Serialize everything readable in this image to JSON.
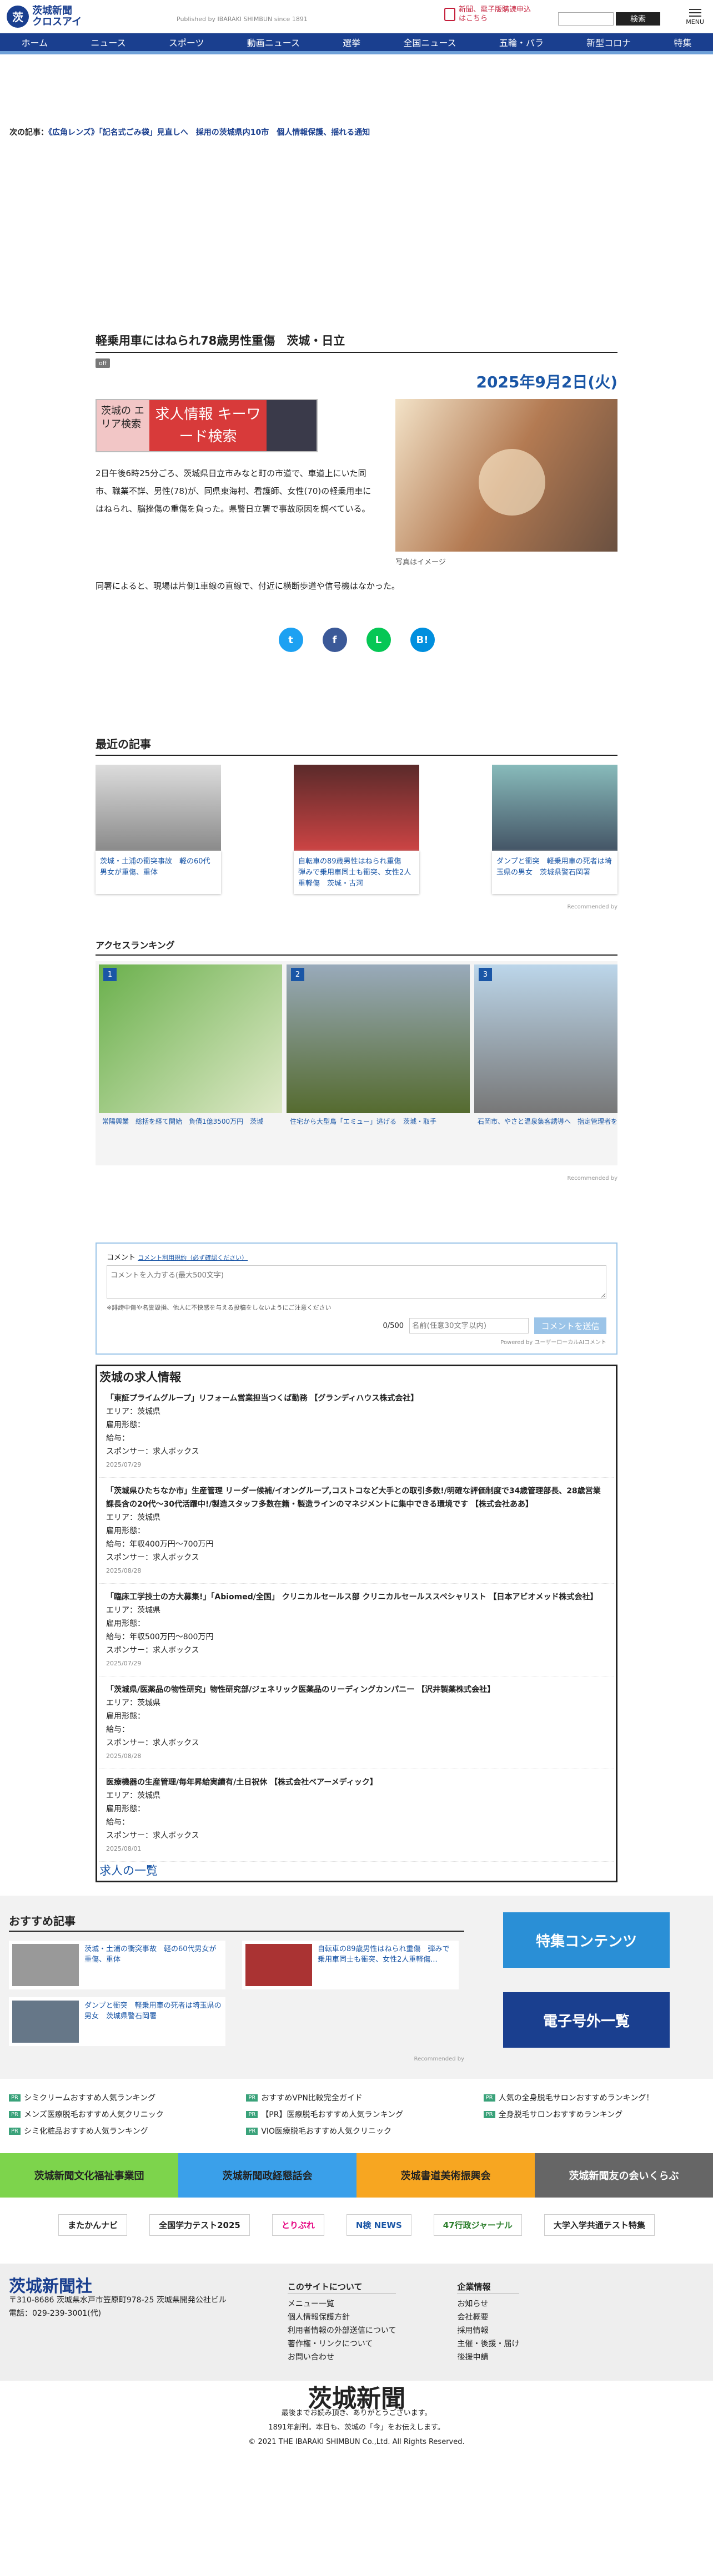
{
  "header": {
    "logo_mark": "茨",
    "logo_text_1": "茨城新聞",
    "logo_text_2": "クロスアイ",
    "published": "Published by IBARAKI SHIMBUN since 1891",
    "subscribe": "新聞、電子版購読申込はこちら",
    "search_button": "検索",
    "menu": "MENU"
  },
  "nav": [
    "ホーム",
    "ニュース",
    "スポーツ",
    "動画ニュース",
    "選挙",
    "全国ニュース",
    "五輪・パラ",
    "新型コロナ",
    "特集"
  ],
  "next": {
    "label": "次の記事：",
    "text": "《広角レンズ》「記名式ごみ袋」見直しへ　採用の茨城県内10市　個人情報保護、揺れる通知"
  },
  "article": {
    "title": "軽乗用車にはねられ78歳男性重傷　茨城・日立",
    "off": "off",
    "date": "2025年9月2日(火)",
    "banner": {
      "left": "茨城の エリア検索",
      "mid": "求人情報 キーワード検索"
    },
    "para1": "2日午後6時25分ごろ、茨城県日立市みなと町の市道で、車道上にいた同市、職業不詳、男性(78)が、同県東海村、看護師、女性(70)の軽乗用車にはねられ、脳挫傷の重傷を負った。県警日立署で事故原因を調べている。",
    "caption": "写真はイメージ",
    "para2": "同署によると、現場は片側1車線の直線で、付近に横断歩道や信号機はなかった。"
  },
  "share": [
    "t",
    "f",
    "L",
    "B!"
  ],
  "recent": {
    "title": "最近の記事",
    "items": [
      "茨城・土浦の衝突事故　軽の60代男女が重傷、重体",
      "自転車の89歳男性はねられ重傷　弾みで乗用車同士も衝突、女性2人重軽傷　茨城・古河",
      "ダンプと衝突　軽乗用車の死者は埼玉県の男女　茨城県警石岡署"
    ],
    "recommended": "Recommended by"
  },
  "ranking": {
    "title": "アクセスランキング",
    "items": [
      {
        "num": "1",
        "text": "常陽興業　総括を経て開始　負債1億3500万円　茨城"
      },
      {
        "num": "2",
        "text": "住宅から大型鳥「エミュー」逃げる　茨城・取手"
      },
      {
        "num": "3",
        "text": "石岡市、やさと温泉集客誘導へ　指定管理者を公募　茨城"
      }
    ]
  },
  "comment": {
    "label": "コメント",
    "rule": "コメント利用規約（必ず確認ください）",
    "placeholder": "コメントを入力する(最大500文字)",
    "note": "※誹謗中傷や名誉毀損、他人に不快感を与える投稿をしないようにご注意ください",
    "count": "0/500",
    "name_placeholder": "名前(任意30文字以内)",
    "submit": "コメントを送信",
    "powered": "Powered by ユーザーローカルAIコメント"
  },
  "jobs": {
    "title": "茨城の求人情報",
    "items": [
      {
        "t": "「東証プライムグループ」リフォーム営業担当つくば勤務 【グランディハウス株式会社】",
        "area": "エリア：茨城県",
        "type": "雇用形態：",
        "pay": "給与：",
        "sponsor": "スポンサー：求人ボックス",
        "date": "2025/07/29"
      },
      {
        "t": "「茨城県ひたちなか市」生産管理 リーダー候補/イオングループ,コストコなど大手との取引多数!/明確な評価制度で34歳管理部長、28歳営業課長含の20代〜30代活躍中!/製造スタッフ多数在籍・製造ラインのマネジメントに集中できる環境です 【株式会社ああ】",
        "area": "エリア：茨城県",
        "type": "雇用形態：",
        "pay": "給与：年収400万円〜700万円",
        "sponsor": "スポンサー：求人ボックス",
        "date": "2025/08/28"
      },
      {
        "t": "「臨床工学技士の方大募集!」「Abiomed/全国」 クリニカルセールス部 クリニカルセールススペシャリスト 【日本アビオメッド株式会社】",
        "area": "エリア：茨城県",
        "type": "雇用形態：",
        "pay": "給与：年収500万円〜800万円",
        "sponsor": "スポンサー：求人ボックス",
        "date": "2025/07/29"
      },
      {
        "t": "「茨城県/医薬品の物性研究」物性研究部/ジェネリック医薬品のリーディングカンパニー 【沢井製薬株式会社】",
        "area": "エリア：茨城県",
        "type": "雇用形態：",
        "pay": "給与：",
        "sponsor": "スポンサー：求人ボックス",
        "date": "2025/08/28"
      },
      {
        "t": "医療機器の生産管理/毎年昇給実績有/土日祝休 【株式会社ベアーメディック】",
        "area": "エリア：茨城県",
        "type": "雇用形態：",
        "pay": "給与：",
        "sponsor": "スポンサー：求人ボックス",
        "date": "2025/08/01"
      }
    ],
    "more": "求人の一覧"
  },
  "bottom": {
    "title": "おすすめ記事",
    "items": [
      "茨城・土浦の衝突事故　軽の60代男女が重傷、重体",
      "自転車の89歳男性はねられ重傷　弾みで乗用車同士も衝突、女性2人重軽傷...",
      "ダンプと衝突　軽乗用車の死者は埼玉県の男女　茨城県警石岡署"
    ],
    "ad1": "特集コンテンツ",
    "ad2": "電子号外一覧"
  },
  "links": [
    "シミクリームおすすめ人気ランキング",
    "おすすめVPN比較完全ガイド",
    "人気の全身脱毛サロンおすすめランキング！",
    "メンズ医療脱毛おすすめ人気クリニック",
    "【PR】医療脱毛おすすめ人気ランキング",
    "全身脱毛サロンおすすめランキング",
    "シミ化粧品おすすめ人気ランキング",
    "VIO医療脱毛おすすめ人気クリニック"
  ],
  "tiles": [
    "茨城新聞文化福祉事業団",
    "茨城新聞政経懇話会",
    "茨城書道美術振興会",
    "茨城新聞友の会いくらぶ"
  ],
  "banners": [
    "またかんナビ",
    "全国学力テスト2025",
    "とりぷれ",
    "N検 NEWS",
    "47行政ジャーナル",
    "大学入学共通テスト特集"
  ],
  "footer": {
    "logo": "茨城新聞社",
    "address": "〒310-8686 茨城県水戸市笠原町978-25 茨城県開発公社ビル",
    "tel": "電話：029-239-3001(代)",
    "site_title": "このサイトについて",
    "site": [
      "メニュー一覧",
      "個人情報保護方針",
      "利用者情報の外部送信について",
      "著作権・リンクについて",
      "お問い合わせ"
    ],
    "corp_title": "企業情報",
    "corp": [
      "お知らせ",
      "会社概要",
      "採用情報",
      "主催・後援・届け",
      "後援申請"
    ],
    "big": "茨城新聞",
    "tag1": "最後までお読み頂き、ありがとうございます。",
    "tag2": "1891年創刊。本日も、茨城の「今」をお伝えします。",
    "copy": "© 2021 THE IBARAKI SHIMBUN Co.,Ltd. All Rights Reserved."
  }
}
